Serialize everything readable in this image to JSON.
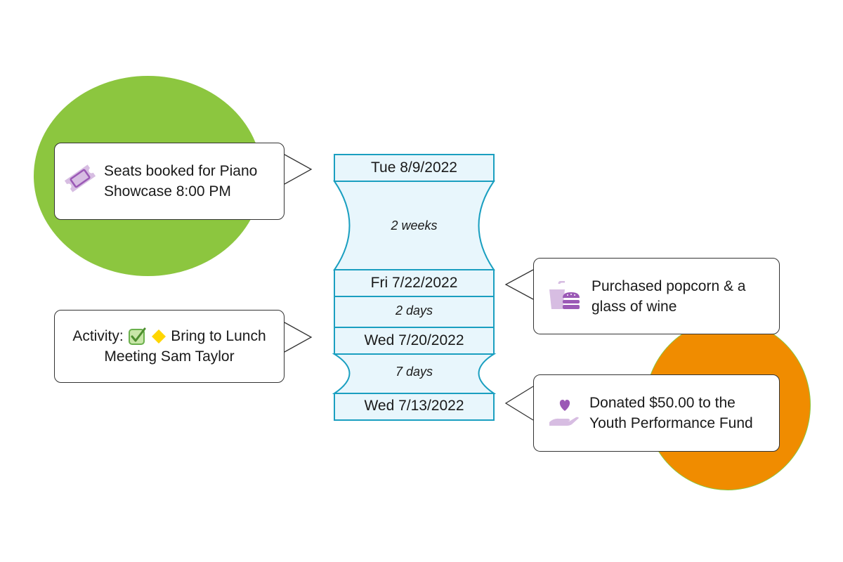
{
  "colors": {
    "green_circle": "#8cc63f",
    "orange_circle": "#f08c00",
    "timeline_fill": "#e8f6fc",
    "timeline_stroke": "#1a9fc0",
    "icon_purple_dark": "#9b59b6",
    "icon_purple_light": "#d7bde2",
    "check_green": "#6ab04c",
    "diamond_yellow": "#ffd600"
  },
  "timeline": {
    "dates": [
      "Tue 8/9/2022",
      "Fri 7/22/2022",
      "Wed 7/20/2022",
      "Wed 7/13/2022"
    ],
    "gaps": [
      "2 weeks",
      "2 days",
      "7 days"
    ]
  },
  "callouts": {
    "seats": {
      "icon": "ticket-icon",
      "line1": "Seats booked for Piano",
      "line2": "Showcase 8:00 PM"
    },
    "activity": {
      "prefix": "Activity:",
      "check_icon": "checkbox-checked-icon",
      "diamond_icon": "diamond-icon",
      "line1_rest": "Bring to Lunch",
      "line2": "Meeting Sam Taylor"
    },
    "food": {
      "icon": "food-drink-icon",
      "line1": "Purchased popcorn & a",
      "line2": "glass of wine"
    },
    "donation": {
      "icon": "donation-hand-heart-icon",
      "line1": "Donated $50.00 to the",
      "line2": "Youth Performance Fund"
    }
  }
}
